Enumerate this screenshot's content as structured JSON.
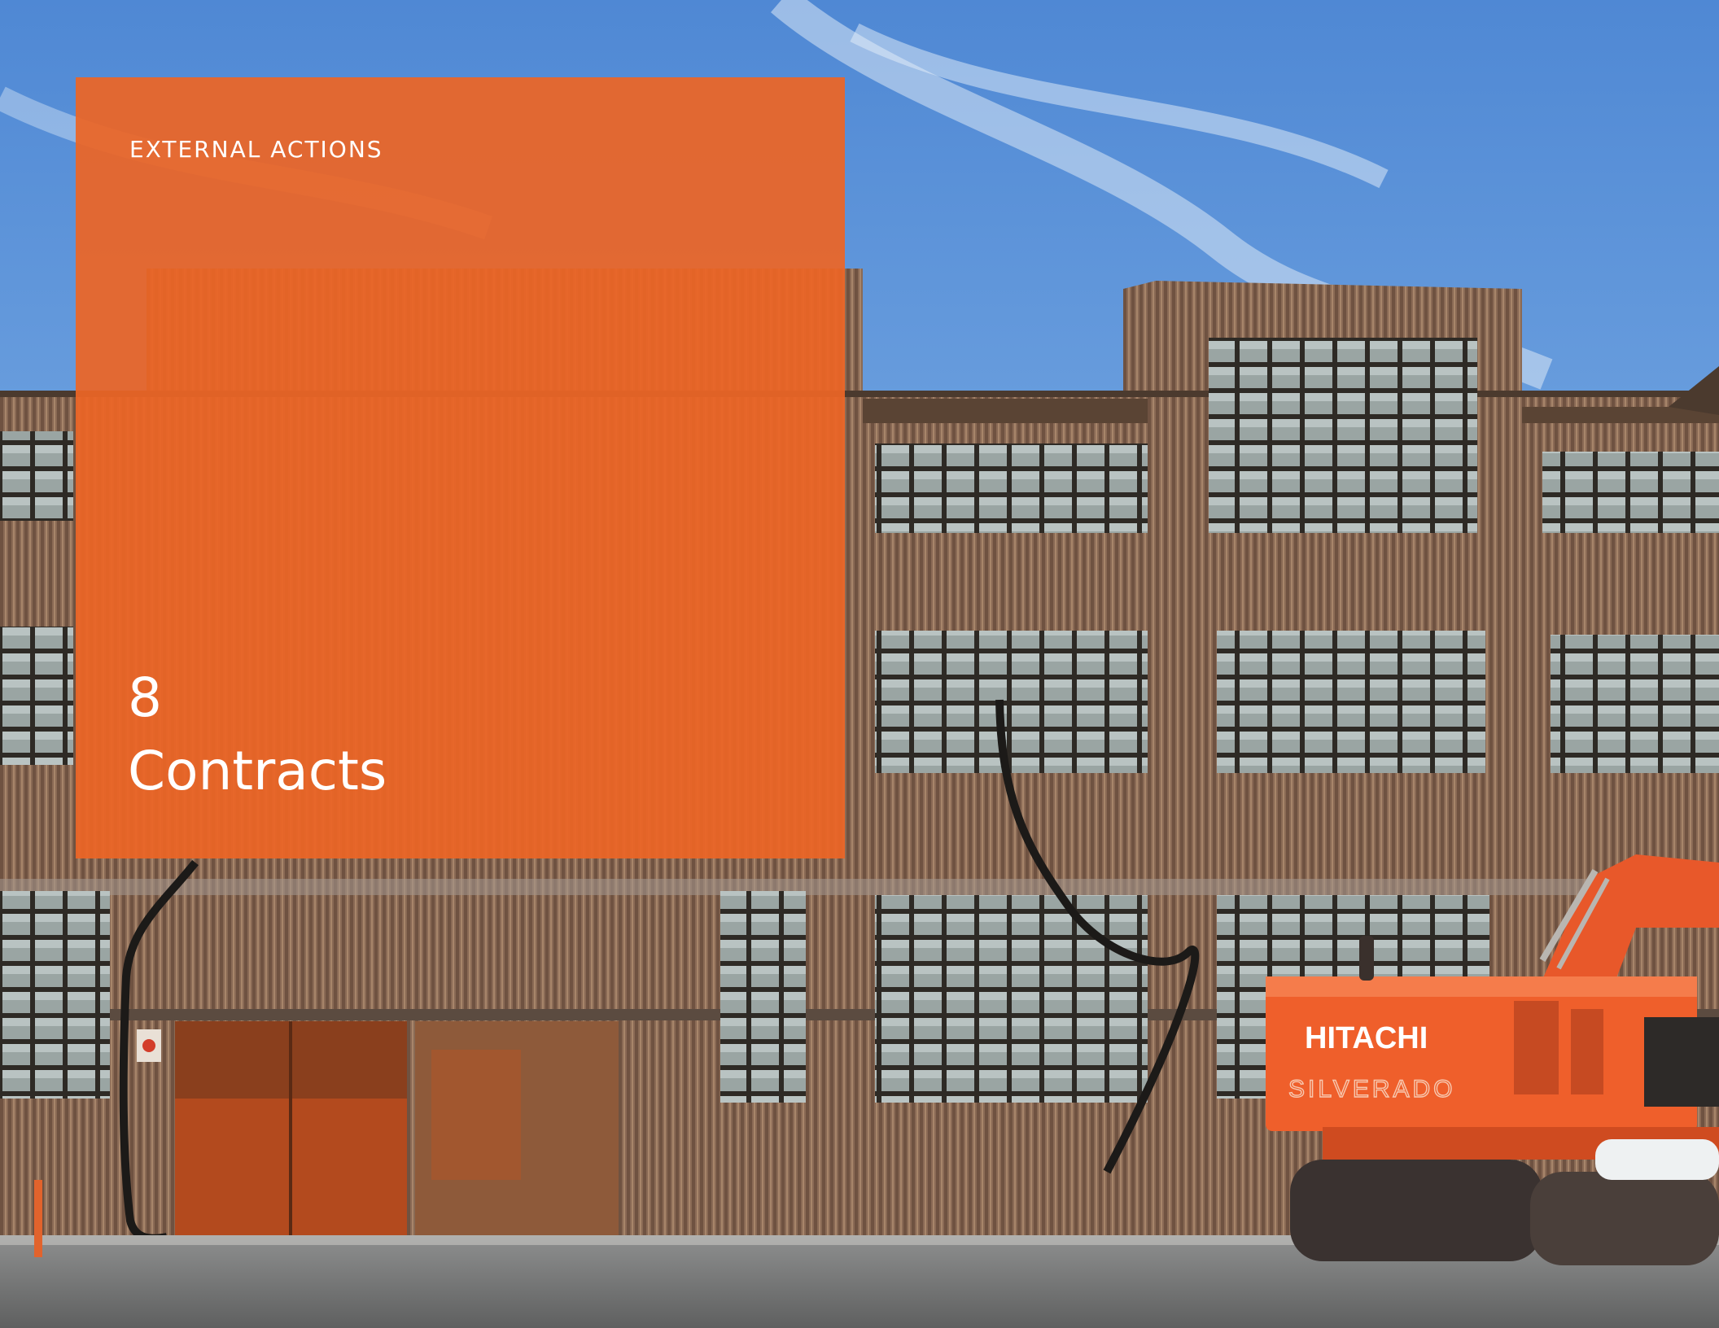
{
  "section": {
    "kicker": "EXTERNAL ACTIONS",
    "number": "8",
    "title": "Contracts"
  },
  "photo": {
    "signage": {
      "brand": "HITACHI",
      "dealer": "SILVERADO"
    }
  },
  "colors": {
    "accent": "#ec6526",
    "text": "#ffffff",
    "sky": "#6e9fd9"
  }
}
